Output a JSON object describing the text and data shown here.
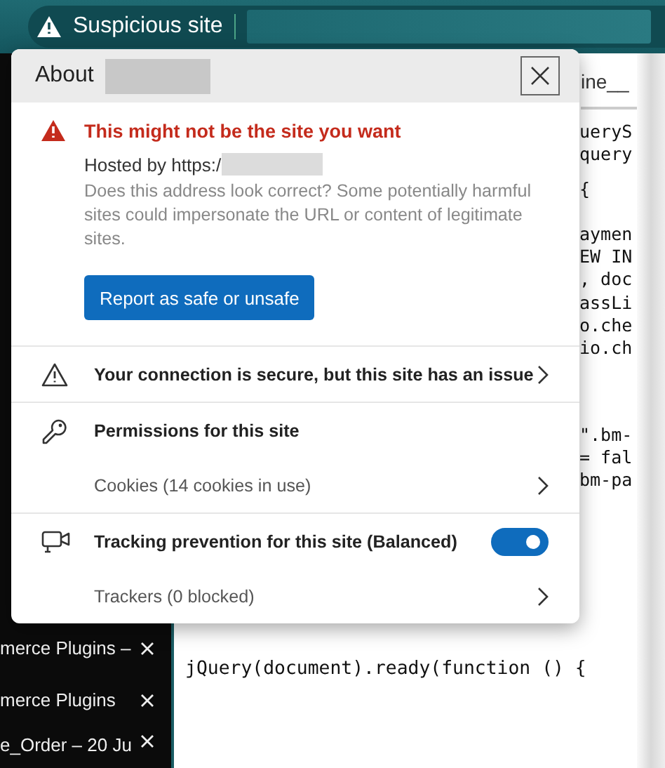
{
  "address_bar": {
    "status": "Suspicious site"
  },
  "sidebar_tabs": [
    {
      "title": "merce Plugins –"
    },
    {
      "title": "merce Plugins"
    },
    {
      "title": "e_Order – 20 Ju"
    }
  ],
  "editor": {
    "tab_fragment": "ine__",
    "code_blocks": [
      [
        "ueryS",
        "query"
      ],
      [
        "{"
      ],
      [
        "aymen",
        "EW IN",
        ", doc",
        "assLi",
        "o.che",
        "io.ch"
      ],
      [
        "\".bm-",
        "= fal",
        "bm-pa"
      ]
    ],
    "code_line": "jQuery(document).ready(function () {"
  },
  "popup": {
    "title": "About",
    "warning": {
      "title": "This might not be the site you want",
      "hosted_by": "Hosted by https:/",
      "description": "Does this address look correct? Some potentially harmful sites could impersonate the URL or content of legitimate sites.",
      "button": "Report as safe or unsafe"
    },
    "sections": [
      [
        {
          "kind": "header-link",
          "label": "Your connection is secure, but this site has an issue"
        }
      ],
      [
        {
          "kind": "header",
          "label": "Permissions for this site"
        },
        {
          "kind": "link",
          "label": "Cookies (14 cookies in use)"
        }
      ],
      [
        {
          "kind": "toggle",
          "label": "Tracking prevention for this site (Balanced)",
          "on": true
        },
        {
          "kind": "link",
          "label": "Trackers (0 blocked)"
        }
      ]
    ]
  }
}
